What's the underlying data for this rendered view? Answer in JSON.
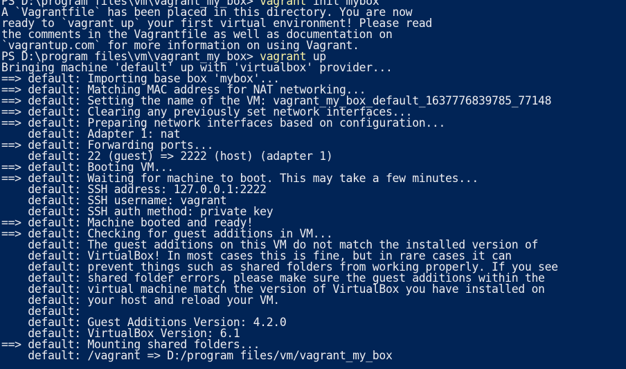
{
  "terminal": {
    "colors": {
      "background": "#012456",
      "text": "#eeedf0",
      "command": "#f9f1a5"
    },
    "lines": [
      {
        "prompt": "PS D:\\program files\\vm\\vagrant_my_box> ",
        "cmd": "vagrant",
        "rest": " init mybox"
      },
      {
        "text": "A `Vagrantfile` has been placed in this directory. You are now"
      },
      {
        "text": "ready to `vagrant up` your first virtual environment! Please read"
      },
      {
        "text": "the comments in the Vagrantfile as well as documentation on"
      },
      {
        "text": "`vagrantup.com` for more information on using Vagrant."
      },
      {
        "prompt": "PS D:\\program files\\vm\\vagrant_my_box> ",
        "cmd": "vagrant",
        "rest": " up"
      },
      {
        "text": "Bringing machine 'default' up with 'virtualbox' provider..."
      },
      {
        "text": "==> default: Importing base box 'mybox'..."
      },
      {
        "text": "==> default: Matching MAC address for NAT networking..."
      },
      {
        "text": "==> default: Setting the name of the VM: vagrant_my_box_default_1637776839785_77148"
      },
      {
        "text": "==> default: Clearing any previously set network interfaces..."
      },
      {
        "text": "==> default: Preparing network interfaces based on configuration..."
      },
      {
        "text": "    default: Adapter 1: nat"
      },
      {
        "text": "==> default: Forwarding ports..."
      },
      {
        "text": "    default: 22 (guest) => 2222 (host) (adapter 1)"
      },
      {
        "text": "==> default: Booting VM..."
      },
      {
        "text": "==> default: Waiting for machine to boot. This may take a few minutes..."
      },
      {
        "text": "    default: SSH address: 127.0.0.1:2222"
      },
      {
        "text": "    default: SSH username: vagrant"
      },
      {
        "text": "    default: SSH auth method: private key"
      },
      {
        "text": "==> default: Machine booted and ready!"
      },
      {
        "text": "==> default: Checking for guest additions in VM..."
      },
      {
        "text": "    default: The guest additions on this VM do not match the installed version of"
      },
      {
        "text": "    default: VirtualBox! In most cases this is fine, but in rare cases it can"
      },
      {
        "text": "    default: prevent things such as shared folders from working properly. If you see"
      },
      {
        "text": "    default: shared folder errors, please make sure the guest additions within the"
      },
      {
        "text": "    default: virtual machine match the version of VirtualBox you have installed on"
      },
      {
        "text": "    default: your host and reload your VM."
      },
      {
        "text": "    default:"
      },
      {
        "text": "    default: Guest Additions Version: 4.2.0"
      },
      {
        "text": "    default: VirtualBox Version: 6.1"
      },
      {
        "text": "==> default: Mounting shared folders..."
      },
      {
        "text": "    default: /vagrant => D:/program files/vm/vagrant_my_box"
      }
    ]
  }
}
